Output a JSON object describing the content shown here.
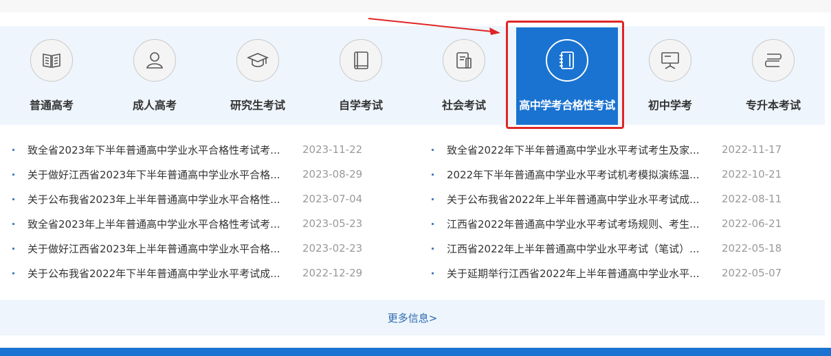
{
  "nav": {
    "items": [
      {
        "label": "普通高考",
        "icon": "open-book-icon"
      },
      {
        "label": "成人高考",
        "icon": "person-icon"
      },
      {
        "label": "研究生考试",
        "icon": "graduation-cap-icon"
      },
      {
        "label": "自学考试",
        "icon": "book-icon"
      },
      {
        "label": "社会考试",
        "icon": "document-icon"
      },
      {
        "label": "高中学考合格性考试",
        "icon": "notebook-icon"
      },
      {
        "label": "初中学考",
        "icon": "presentation-board-icon"
      },
      {
        "label": "专升本考试",
        "icon": "book-stack-icon"
      }
    ],
    "active_index": 5
  },
  "news": {
    "left": [
      {
        "title": "致全省2023年下半年普通高中学业水平合格性考试考...",
        "date": "2023-11-22"
      },
      {
        "title": "关于做好江西省2023年下半年普通高中学业水平合格...",
        "date": "2023-08-29"
      },
      {
        "title": "关于公布我省2023年上半年普通高中学业水平合格性...",
        "date": "2023-07-04"
      },
      {
        "title": "致全省2023年上半年普通高中学业水平合格性考试考...",
        "date": "2023-05-23"
      },
      {
        "title": "关于做好江西省2023年上半年普通高中学业水平合格...",
        "date": "2023-02-23"
      },
      {
        "title": "关于公布我省2022年下半年普通高中学业水平考试成...",
        "date": "2022-12-29"
      }
    ],
    "right": [
      {
        "title": "致全省2022年下半年普通高中学业水平考试考生及家...",
        "date": "2022-11-17"
      },
      {
        "title": "2022年下半年普通高中学业水平考试机考模拟演练温...",
        "date": "2022-10-21"
      },
      {
        "title": "关于公布我省2022年上半年普通高中学业水平考试成...",
        "date": "2022-08-11"
      },
      {
        "title": "江西省2022年普通高中学业水平考试考场规则、考生...",
        "date": "2022-06-21"
      },
      {
        "title": "江西省2022年上半年普通高中学业水平考试（笔试）...",
        "date": "2022-05-18"
      },
      {
        "title": "关于延期举行江西省2022年上半年普通高中学业水平...",
        "date": "2022-05-07"
      }
    ]
  },
  "more": {
    "label": "更多信息>"
  },
  "colors": {
    "accent": "#1a73d1",
    "band": "#eef5fc",
    "highlight": "#e02424",
    "date": "#999999"
  }
}
